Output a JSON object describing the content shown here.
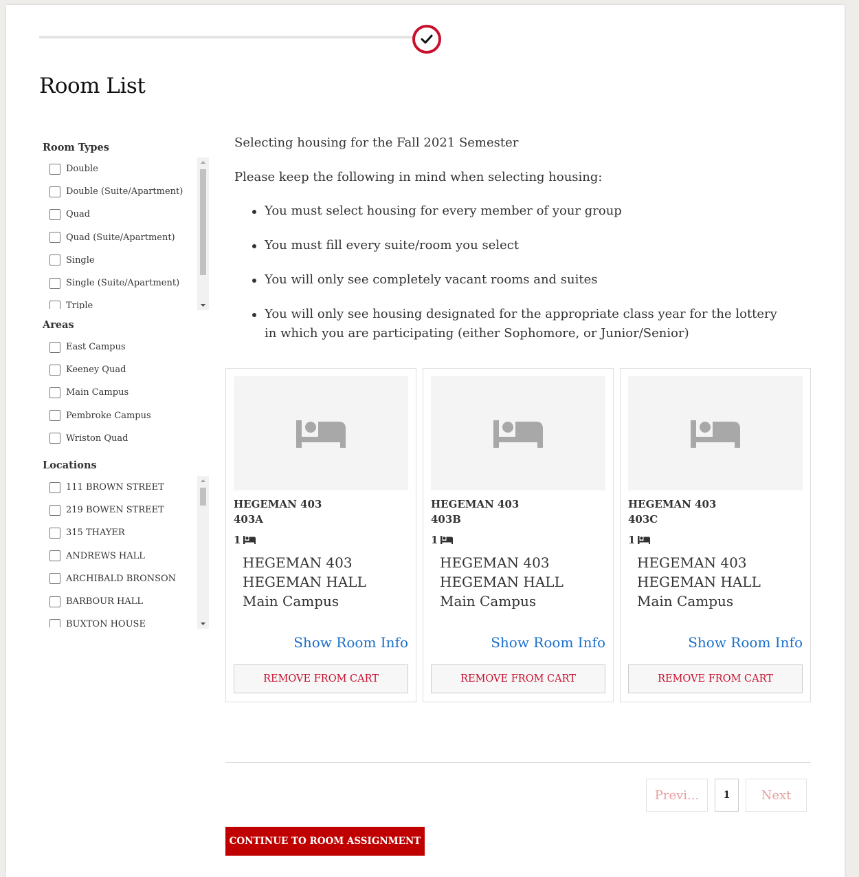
{
  "page": {
    "title": "Room List"
  },
  "filters": {
    "room_types": {
      "heading": "Room Types",
      "items": [
        "Double",
        "Double (Suite/Apartment)",
        "Quad",
        "Quad (Suite/Apartment)",
        "Single",
        "Single (Suite/Apartment)",
        "Triple"
      ]
    },
    "areas": {
      "heading": "Areas",
      "items": [
        "East Campus",
        "Keeney Quad",
        "Main Campus",
        "Pembroke Campus",
        "Wriston Quad"
      ]
    },
    "locations": {
      "heading": "Locations",
      "items": [
        "111 BROWN STREET",
        "219 BOWEN STREET",
        "315 THAYER",
        "ANDREWS HALL",
        "ARCHIBALD BRONSON",
        "BARBOUR HALL",
        "BUXTON HOUSE"
      ]
    }
  },
  "intro": {
    "semester": "Selecting housing for the Fall 2021 Semester",
    "keep_in_mind": "Please keep the following in mind when selecting housing:",
    "bullets": [
      "You must select housing for every member of your group",
      "You must fill every suite/room you select",
      "You will only see completely vacant rooms and suites",
      "You will only see housing designated for the appropriate class year for the lottery in which you are participating (either Sophomore, or Junior/Senior)"
    ]
  },
  "cards": [
    {
      "name": "HEGEMAN 403",
      "room": "403A",
      "beds": "1",
      "address": [
        "HEGEMAN 403",
        "HEGEMAN HALL",
        "Main Campus"
      ],
      "info_link": "Show Room Info",
      "remove_label": "REMOVE FROM CART"
    },
    {
      "name": "HEGEMAN 403",
      "room": "403B",
      "beds": "1",
      "address": [
        "HEGEMAN 403",
        "HEGEMAN HALL",
        "Main Campus"
      ],
      "info_link": "Show Room Info",
      "remove_label": "REMOVE FROM CART"
    },
    {
      "name": "HEGEMAN 403",
      "room": "403C",
      "beds": "1",
      "address": [
        "HEGEMAN 403",
        "HEGEMAN HALL",
        "Main Campus"
      ],
      "info_link": "Show Room Info",
      "remove_label": "REMOVE FROM CART"
    }
  ],
  "pagination": {
    "prev": "Previ...",
    "current": "1",
    "next": "Next"
  },
  "continue_label": "CONTINUE TO ROOM ASSIGNMENT",
  "colors": {
    "accent": "#c8102e",
    "button": "#c00000",
    "link": "#1a6fc9"
  },
  "icons": {
    "progress": "check-icon",
    "room_image": "bed-icon",
    "beds": "bed-icon"
  }
}
